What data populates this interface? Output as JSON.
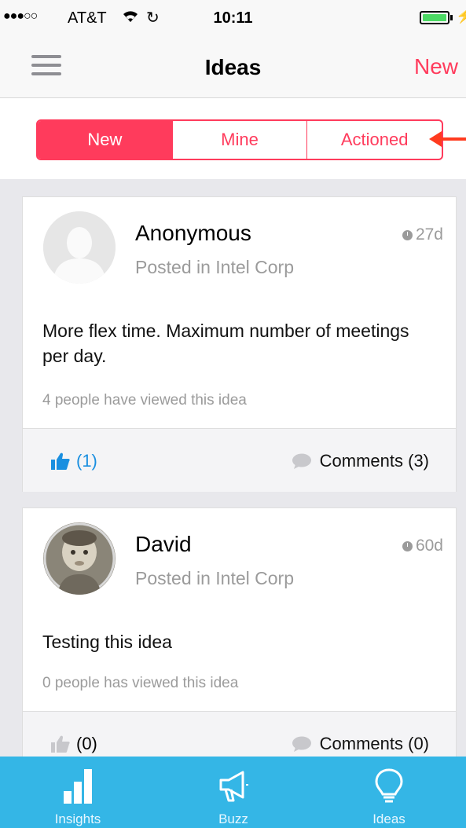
{
  "status_bar": {
    "signal": "●●●○○",
    "carrier": "AT&T",
    "wifi_icon": "wifi-icon",
    "sync_icon": "sync-icon",
    "time": "10:11",
    "battery_icon": "battery-icon",
    "charging_icon": "bolt-icon"
  },
  "nav": {
    "menu_icon": "hamburger-icon",
    "title": "Ideas",
    "new_label": "New",
    "accent": "#ff3b5c"
  },
  "segments": [
    {
      "label": "New",
      "active": true
    },
    {
      "label": "Mine",
      "active": false
    },
    {
      "label": "Actioned",
      "active": false
    }
  ],
  "ideas": [
    {
      "author": "Anonymous",
      "posted_in": "Posted in Intel Corp",
      "age": "27d",
      "text": "More flex time. Maximum number of meetings per day.",
      "views": "4 people have viewed this idea",
      "likes": "(1)",
      "liked": true,
      "comments": "Comments (3)"
    },
    {
      "author": "David",
      "posted_in": "Posted in Intel Corp",
      "age": "60d",
      "text": "Testing this idea",
      "views": "0 people has viewed this idea",
      "likes": "(0)",
      "liked": false,
      "comments": "Comments (0)"
    }
  ],
  "tabbar": {
    "color": "#34b6e6",
    "tabs": [
      {
        "label": "Insights",
        "icon": "bar-chart-icon"
      },
      {
        "label": "Buzz",
        "icon": "megaphone-icon"
      },
      {
        "label": "Ideas",
        "icon": "lightbulb-icon"
      }
    ]
  }
}
